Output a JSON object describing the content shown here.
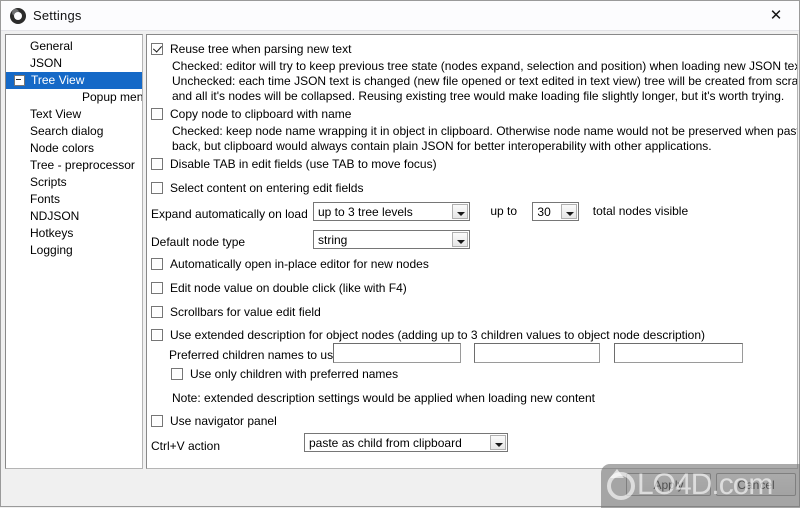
{
  "window": {
    "title": "Settings",
    "app_icon": "app-circle-icon",
    "close_label": "✕"
  },
  "sidebar": {
    "items": [
      {
        "label": "General",
        "level": 1,
        "expander": "none",
        "selected": false
      },
      {
        "label": "JSON",
        "level": 1,
        "expander": "none",
        "selected": false
      },
      {
        "label": "Tree View",
        "level": 1,
        "expander": "collapse",
        "selected": true
      },
      {
        "label": "Popup menu",
        "level": 2,
        "expander": "none",
        "selected": false
      },
      {
        "label": "Text View",
        "level": 1,
        "expander": "none",
        "selected": false
      },
      {
        "label": "Search dialog",
        "level": 1,
        "expander": "none",
        "selected": false
      },
      {
        "label": "Node colors",
        "level": 1,
        "expander": "none",
        "selected": false
      },
      {
        "label": "Tree - preprocessor",
        "level": 1,
        "expander": "none",
        "selected": false
      },
      {
        "label": "Scripts",
        "level": 1,
        "expander": "none",
        "selected": false
      },
      {
        "label": "Fonts",
        "level": 1,
        "expander": "none",
        "selected": false
      },
      {
        "label": "NDJSON",
        "level": 1,
        "expander": "none",
        "selected": false
      },
      {
        "label": "Hotkeys",
        "level": 1,
        "expander": "none",
        "selected": false
      },
      {
        "label": "Logging",
        "level": 1,
        "expander": "none",
        "selected": false
      }
    ]
  },
  "main": {
    "reuse_tree": {
      "label": "Reuse tree when parsing new text",
      "checked": true,
      "desc_line1": "Checked: editor will try to keep previous tree state (nodes expand, selection and position) when loading new JSON text.",
      "desc_line2": "Unchecked: each time JSON text is changed (new file opened or text edited in text view) tree will be created from scratch",
      "desc_line3": "and all it's nodes will be collapsed. Reusing existing tree would make loading file slightly longer, but it's worth trying."
    },
    "copy_node": {
      "label": "Copy node to clipboard with name",
      "checked": false,
      "desc_line1": "Checked: keep node name wrapping it in object in clipboard. Otherwise node name would not be preserved when pasting",
      "desc_line2": "back, but clipboard would always contain plain JSON for better interoperability with other applications."
    },
    "disable_tab": {
      "label": "Disable TAB in edit fields (use TAB to move focus)",
      "checked": false
    },
    "select_content": {
      "label": "Select content on entering edit fields",
      "checked": false
    },
    "expand_auto": {
      "label": "Expand automatically on load",
      "value": "up to 3 tree levels",
      "mid_label": "up to",
      "count_value": "30",
      "suffix_label": "total nodes visible"
    },
    "default_node_type": {
      "label": "Default node type",
      "value": "string"
    },
    "auto_open_editor": {
      "label": "Automatically open in-place editor for new nodes",
      "checked": false
    },
    "edit_on_dblclick": {
      "label": "Edit node value on double click (like with F4)",
      "checked": false
    },
    "scrollbars": {
      "label": "Scrollbars for value edit field",
      "checked": false
    },
    "extended_desc": {
      "label": "Use extended description for object nodes (adding up to 3 children values to object node description)",
      "checked": false
    },
    "preferred_children": {
      "label": "Preferred children names to use",
      "field1": "",
      "field2": "",
      "field3": ""
    },
    "only_preferred": {
      "label": "Use only children with preferred names",
      "checked": false
    },
    "note": "Note: extended description settings would be applied when loading new content",
    "navigator_panel": {
      "label": "Use navigator panel",
      "checked": false
    },
    "ctrl_v": {
      "label": "Ctrl+V action",
      "value": "paste as child from clipboard"
    }
  },
  "footer": {
    "apply_label": "Apply",
    "cancel_label": "Cancel"
  },
  "watermark": {
    "text": "LO4D.com"
  }
}
